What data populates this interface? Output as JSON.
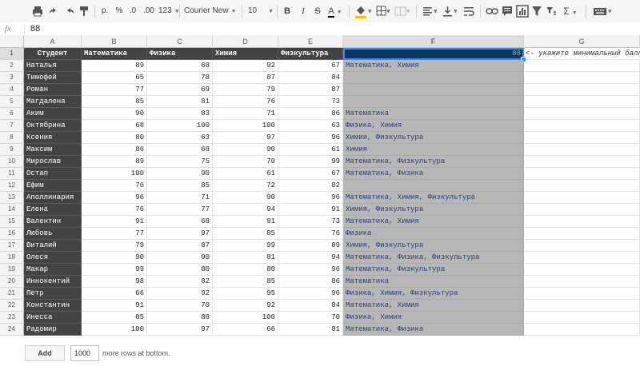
{
  "toolbar": {
    "currency": "р.",
    "percent": "%",
    "dec_decrease": ".0",
    "dec_increase": ".00",
    "more_formats": "123",
    "font": "Courier New",
    "font_size": "10",
    "bold": "B",
    "italic": "I",
    "strike": "S",
    "text_color": "A",
    "sigma": "Σ"
  },
  "formula": {
    "fx": "fx",
    "value": "88"
  },
  "columns": [
    "A",
    "B",
    "C",
    "D",
    "E",
    "F",
    "G"
  ],
  "sheet": {
    "header_row": [
      "Студент",
      "Математика",
      "Физика",
      "Химия",
      "Физкультура"
    ],
    "threshold": "88",
    "hint": "<- укажите минимальный балл",
    "rows": [
      {
        "name": "Наталья",
        "scores": [
          "89",
          "68",
          "92",
          "67"
        ],
        "result": "Математика, Химия"
      },
      {
        "name": "Тимофей",
        "scores": [
          "65",
          "78",
          "87",
          "84"
        ],
        "result": ""
      },
      {
        "name": "Роман",
        "scores": [
          "77",
          "69",
          "79",
          "87"
        ],
        "result": ""
      },
      {
        "name": "Магдалена",
        "scores": [
          "85",
          "81",
          "76",
          "73"
        ],
        "result": ""
      },
      {
        "name": "Аким",
        "scores": [
          "90",
          "83",
          "71",
          "86"
        ],
        "result": "Математика"
      },
      {
        "name": "Октябрина",
        "scores": [
          "68",
          "100",
          "100",
          "63"
        ],
        "result": "Физика, Химия"
      },
      {
        "name": "Ксения",
        "scores": [
          "80",
          "63",
          "97",
          "96"
        ],
        "result": "Химия, Физкультура"
      },
      {
        "name": "Максим",
        "scores": [
          "86",
          "68",
          "90",
          "61"
        ],
        "result": "Химия"
      },
      {
        "name": "Мирослав",
        "scores": [
          "89",
          "75",
          "70",
          "99"
        ],
        "result": "Математика, Физкультура"
      },
      {
        "name": "Остап",
        "scores": [
          "100",
          "90",
          "61",
          "67"
        ],
        "result": "Математика, Физика"
      },
      {
        "name": "Ефим",
        "scores": [
          "76",
          "85",
          "72",
          "82"
        ],
        "result": ""
      },
      {
        "name": "Аполлинария",
        "scores": [
          "96",
          "71",
          "90",
          "96"
        ],
        "result": "Математика, Химия, Физкультура"
      },
      {
        "name": "Елена",
        "scores": [
          "76",
          "77",
          "94",
          "91"
        ],
        "result": "Химия, Физкультура"
      },
      {
        "name": "Валентин",
        "scores": [
          "91",
          "68",
          "91",
          "73"
        ],
        "result": "Математика, Химия"
      },
      {
        "name": "Любовь",
        "scores": [
          "77",
          "97",
          "85",
          "76"
        ],
        "result": "Физика"
      },
      {
        "name": "Виталий",
        "scores": [
          "79",
          "87",
          "99",
          "89"
        ],
        "result": "Химия, Физкультура"
      },
      {
        "name": "Олеся",
        "scores": [
          "90",
          "90",
          "81",
          "94"
        ],
        "result": "Математика, Физика, Физкультура"
      },
      {
        "name": "Макар",
        "scores": [
          "99",
          "80",
          "80",
          "96"
        ],
        "result": "Математика, Физкультура"
      },
      {
        "name": "Иннокентий",
        "scores": [
          "98",
          "82",
          "85",
          "86"
        ],
        "result": "Математика"
      },
      {
        "name": "Петр",
        "scores": [
          "66",
          "92",
          "95",
          "96"
        ],
        "result": "Физика, Химия, Физкультура"
      },
      {
        "name": "Константин",
        "scores": [
          "91",
          "70",
          "92",
          "84"
        ],
        "result": "Математика, Химия"
      },
      {
        "name": "Инесса",
        "scores": [
          "85",
          "88",
          "100",
          "70"
        ],
        "result": "Физика, Химия"
      },
      {
        "name": "Радомир",
        "scores": [
          "100",
          "97",
          "66",
          "81"
        ],
        "result": "Математика, Физика"
      }
    ]
  },
  "footer": {
    "add_label": "Add",
    "rows_value": "1000",
    "more_text": "more rows at bottom."
  }
}
